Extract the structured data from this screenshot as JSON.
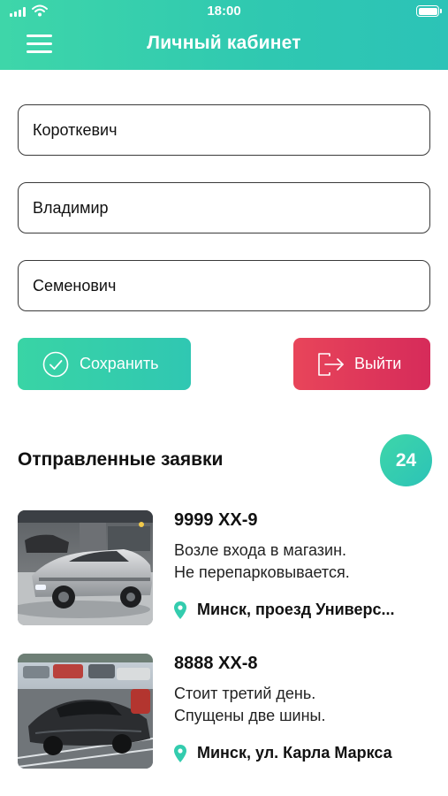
{
  "status_bar": {
    "time": "18:00",
    "icons": [
      "signal-icon",
      "wifi-icon",
      "battery-icon"
    ]
  },
  "header": {
    "title": "Личный кабинет",
    "menu_icon": "hamburger-menu-icon"
  },
  "form": {
    "last_name": "Короткевич",
    "first_name": "Владимир",
    "middle_name": "Семенович"
  },
  "actions": {
    "save_label": "Сохранить",
    "save_icon": "check-circle-icon",
    "exit_label": "Выйти",
    "exit_icon": "logout-icon"
  },
  "requests": {
    "title": "Отправленные заявки",
    "count": "24",
    "items": [
      {
        "plate": "9999 XX-9",
        "description_line1": "Возле входа в магазин.",
        "description_line2": "Не перепарковывается.",
        "address": "Минск, проезд Универс...",
        "location_icon": "map-pin-icon",
        "photo": "car-photo"
      },
      {
        "plate": "8888 XX-8",
        "description_line1": "Стоит третий день.",
        "description_line2": "Спущены две шины.",
        "address": "Минск, ул. Карла Маркса",
        "location_icon": "map-pin-icon",
        "photo": "car-photo"
      }
    ]
  },
  "colors": {
    "accent_green": "#34cdad",
    "exit_red": "#e0355a",
    "text_dark": "#111111"
  }
}
